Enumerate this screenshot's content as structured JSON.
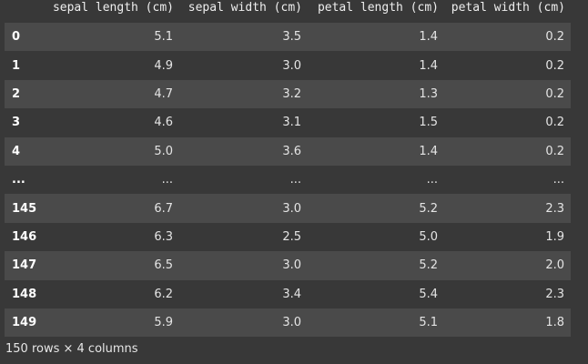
{
  "dataframe": {
    "columns": [
      "sepal length (cm)",
      "sepal width (cm)",
      "petal length (cm)",
      "petal width (cm)"
    ],
    "rows": [
      {
        "index": "0",
        "values": [
          "5.1",
          "3.5",
          "1.4",
          "0.2"
        ]
      },
      {
        "index": "1",
        "values": [
          "4.9",
          "3.0",
          "1.4",
          "0.2"
        ]
      },
      {
        "index": "2",
        "values": [
          "4.7",
          "3.2",
          "1.3",
          "0.2"
        ]
      },
      {
        "index": "3",
        "values": [
          "4.6",
          "3.1",
          "1.5",
          "0.2"
        ]
      },
      {
        "index": "4",
        "values": [
          "5.0",
          "3.6",
          "1.4",
          "0.2"
        ]
      },
      {
        "index": "...",
        "values": [
          "...",
          "...",
          "...",
          "..."
        ]
      },
      {
        "index": "145",
        "values": [
          "6.7",
          "3.0",
          "5.2",
          "2.3"
        ]
      },
      {
        "index": "146",
        "values": [
          "6.3",
          "2.5",
          "5.0",
          "1.9"
        ]
      },
      {
        "index": "147",
        "values": [
          "6.5",
          "3.0",
          "5.2",
          "2.0"
        ]
      },
      {
        "index": "148",
        "values": [
          "6.2",
          "3.4",
          "5.4",
          "2.3"
        ]
      },
      {
        "index": "149",
        "values": [
          "5.9",
          "3.0",
          "5.1",
          "1.8"
        ]
      }
    ],
    "footer": "150 rows × 4 columns"
  },
  "colors": {
    "background": "#383838",
    "row_stripe": "#4a4a4a",
    "text": "#e4e4e4"
  }
}
